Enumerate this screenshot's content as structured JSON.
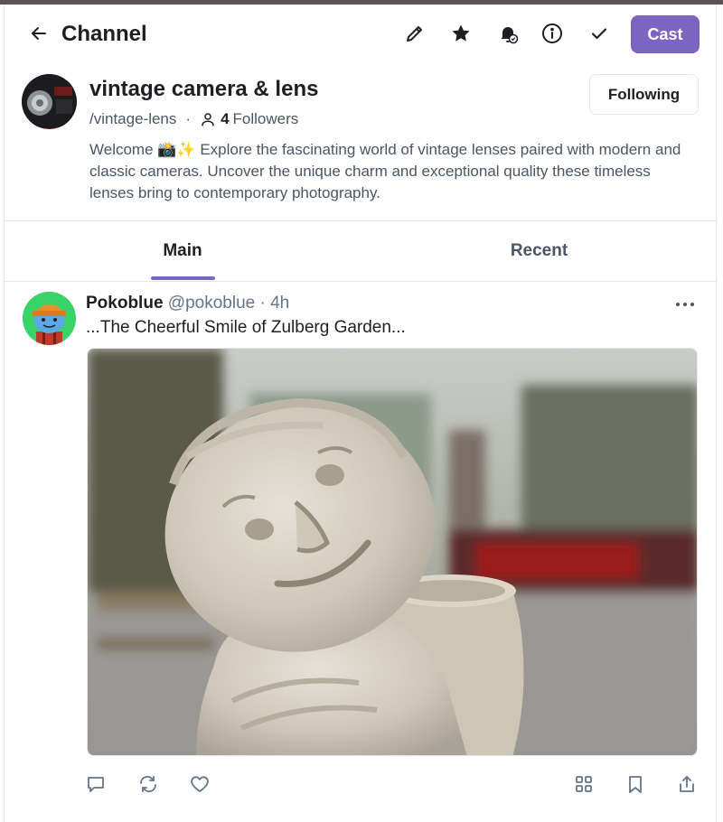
{
  "header": {
    "title": "Channel",
    "cast_label": "Cast",
    "icons": [
      "back-arrow-icon",
      "pencil-icon",
      "star-icon",
      "bell-check-icon",
      "info-icon",
      "check-icon"
    ]
  },
  "channel": {
    "name": "vintage camera & lens",
    "handle": "/vintage-lens",
    "separator": "·",
    "followers_count": "4",
    "followers_label": "Followers",
    "follow_button_label": "Following",
    "description": "Welcome 📸✨ Explore the fascinating world of vintage lenses paired with modern and classic cameras. Uncover the unique charm and exceptional quality these timeless lenses bring to contemporary photography."
  },
  "tabs": [
    {
      "label": "Main",
      "active": true
    },
    {
      "label": "Recent",
      "active": false
    }
  ],
  "post": {
    "display_name": "Pokoblue",
    "username": "@pokoblue",
    "separator": "·",
    "time": "4h",
    "text": "...The Cheerful Smile of Zulberg Garden...",
    "image_description_icon": "photo-stone-statue",
    "actions": [
      "reply-icon",
      "recast-icon",
      "like-icon",
      "grid-icon",
      "bookmark-icon",
      "share-icon"
    ]
  },
  "colors": {
    "accent": "#7c65c1",
    "text_primary": "#1f1f23",
    "text_secondary": "#4b5563",
    "border": "#e5e7eb"
  }
}
